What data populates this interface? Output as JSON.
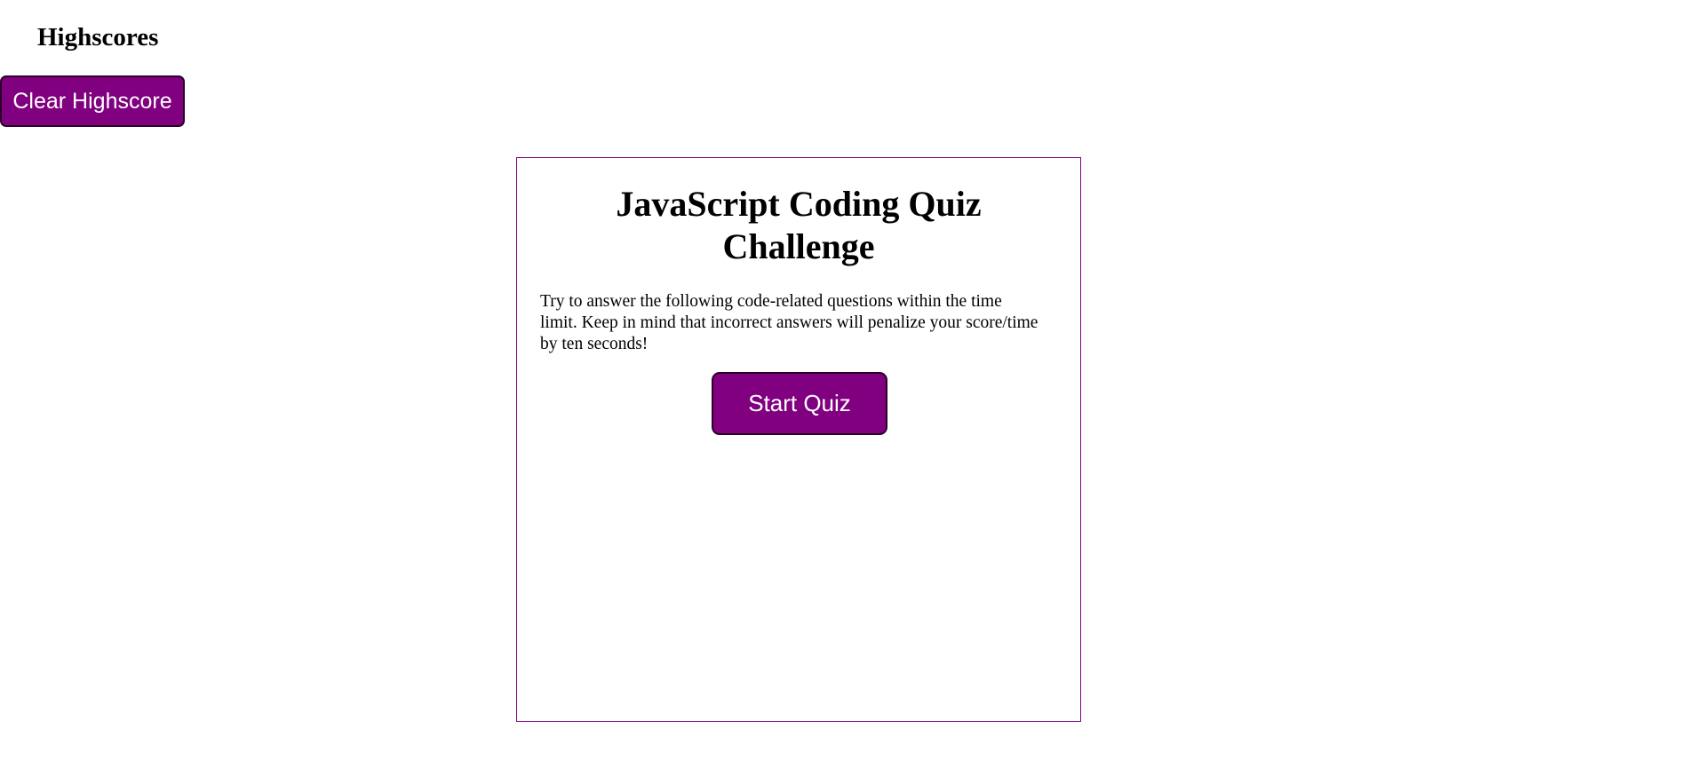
{
  "header": {
    "highscores_label": "Highscores",
    "clear_button_label": "Clear Highscore"
  },
  "quiz": {
    "title_line1": "JavaScript Coding Quiz",
    "title_line2": "Challenge",
    "intro_line1": "Try to answer the following code-related questions within the time",
    "intro_line2": "limit. Keep in mind that incorrect answers will penalize your score/time",
    "intro_line3": "by ten seconds!",
    "start_button_label": "Start Quiz"
  },
  "colors": {
    "accent": "#800080",
    "button_text": "#ffffff",
    "card_border": "#800080"
  }
}
